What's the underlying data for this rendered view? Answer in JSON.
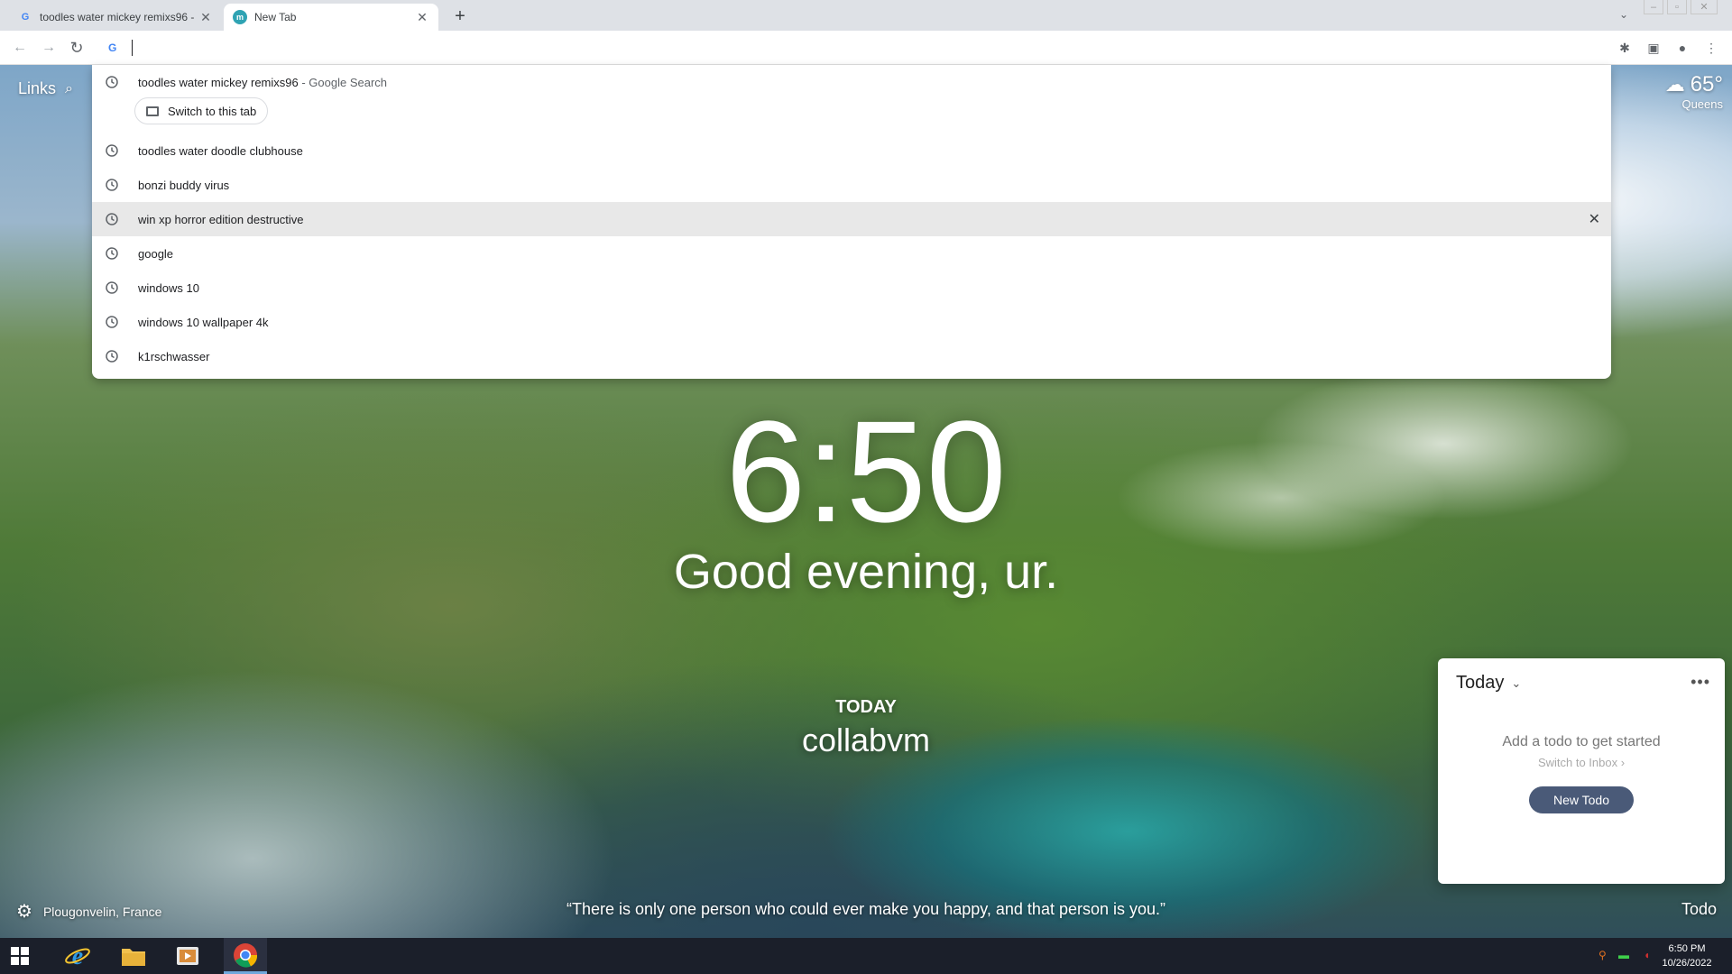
{
  "tabs": [
    {
      "title": "toodles water mickey remixs96 -",
      "favicon": "G",
      "active": false
    },
    {
      "title": "New Tab",
      "favicon": "m",
      "active": true
    }
  ],
  "omnibox": {
    "value": "",
    "placeholder": ""
  },
  "dropdown": {
    "first": {
      "query": "toodles water mickey remixs96",
      "source": " - Google Search"
    },
    "switch_tab_label": "Switch to this tab",
    "items": [
      "toodles water doodle clubhouse",
      "bonzi buddy virus",
      "win xp horror edition destructive",
      "google",
      "windows 10",
      "windows 10 wallpaper 4k",
      "k1rschwasser"
    ],
    "remove_symbol": "✕"
  },
  "momentum": {
    "links_label": "Links",
    "weather": {
      "temp": "65°",
      "location": "Queens"
    },
    "time": "6:50",
    "greeting": "Good evening, ur.",
    "focus_label": "TODAY",
    "focus_text": "collabvm",
    "quote": "“There is only one person who could ever make you happy, and that person is you.”",
    "photo_location": "Plougonvelin, France",
    "todo_toggle": "Todo"
  },
  "todo": {
    "list_name": "Today",
    "empty_message": "Add a todo to get started",
    "switch_inbox": "Switch to Inbox",
    "new_button": "New Todo"
  },
  "taskbar": {
    "time": "6:50 PM",
    "date": "10/26/2022"
  },
  "colors": {
    "accent": "#4285f4",
    "todo_button": "#4a5a78",
    "taskbar": "#1b1f2a"
  }
}
